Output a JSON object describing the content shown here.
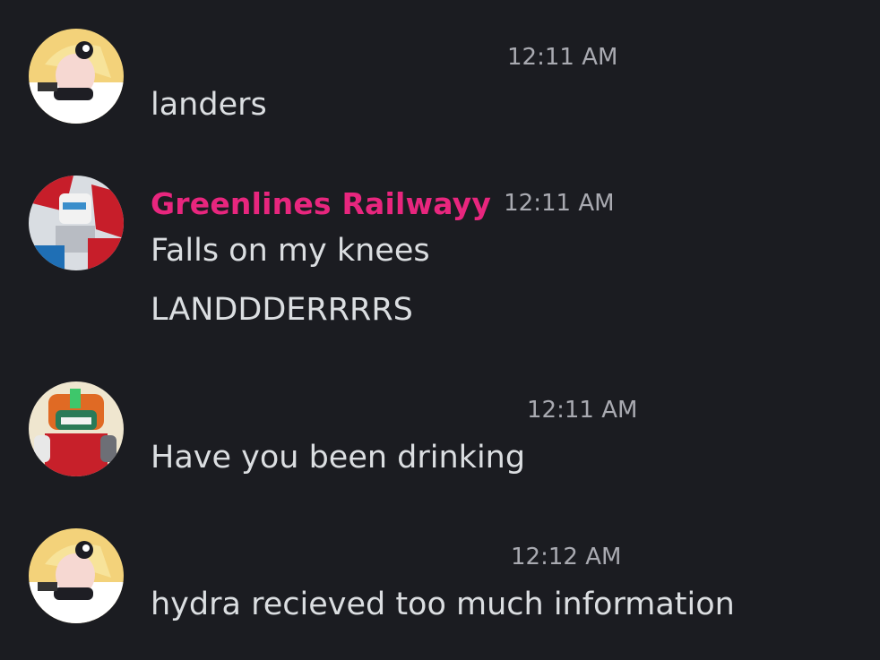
{
  "messages": [
    {
      "author": "",
      "author_color": "#e8267e",
      "timestamp": "12:11 AM",
      "avatar": "yellow-haired-cartoon-avatar",
      "lines": [
        "landers"
      ]
    },
    {
      "author": "Greenlines Railwayy",
      "author_color": "#e8267e",
      "timestamp": "12:11 AM",
      "avatar": "red-robot-avatar",
      "lines": [
        "Falls on my knees",
        "LANDDDERRRRS"
      ]
    },
    {
      "author": "",
      "author_color": "#e8267e",
      "timestamp": "12:11 AM",
      "avatar": "orange-robot-avatar",
      "lines": [
        "Have you been drinking"
      ]
    },
    {
      "author": "",
      "author_color": "#e8267e",
      "timestamp": "12:12 AM",
      "avatar": "yellow-haired-cartoon-avatar",
      "lines": [
        "hydra recieved too much information"
      ]
    }
  ]
}
